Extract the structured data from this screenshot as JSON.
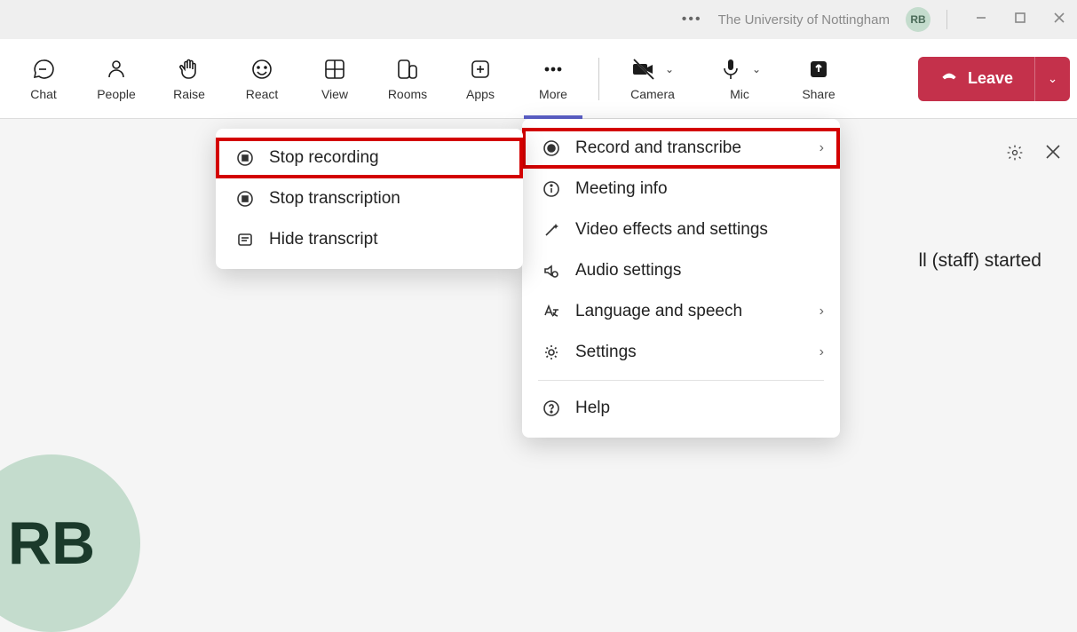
{
  "titlebar": {
    "org_name": "The University of Nottingham",
    "avatar_initials": "RB"
  },
  "toolbar": {
    "chat": "Chat",
    "people": "People",
    "raise": "Raise",
    "react": "React",
    "view": "View",
    "rooms": "Rooms",
    "apps": "Apps",
    "more": "More",
    "camera": "Camera",
    "mic": "Mic",
    "share": "Share",
    "leave": "Leave"
  },
  "more_menu": {
    "record_transcribe": "Record and transcribe",
    "meeting_info": "Meeting info",
    "video_effects": "Video effects and settings",
    "audio_settings": "Audio settings",
    "language_speech": "Language and speech",
    "settings": "Settings",
    "help": "Help"
  },
  "record_submenu": {
    "stop_recording": "Stop recording",
    "stop_transcription": "Stop transcription",
    "hide_transcript": "Hide transcript"
  },
  "content": {
    "avatar_initials": "RB",
    "partial_message": "ll (staff) started"
  }
}
